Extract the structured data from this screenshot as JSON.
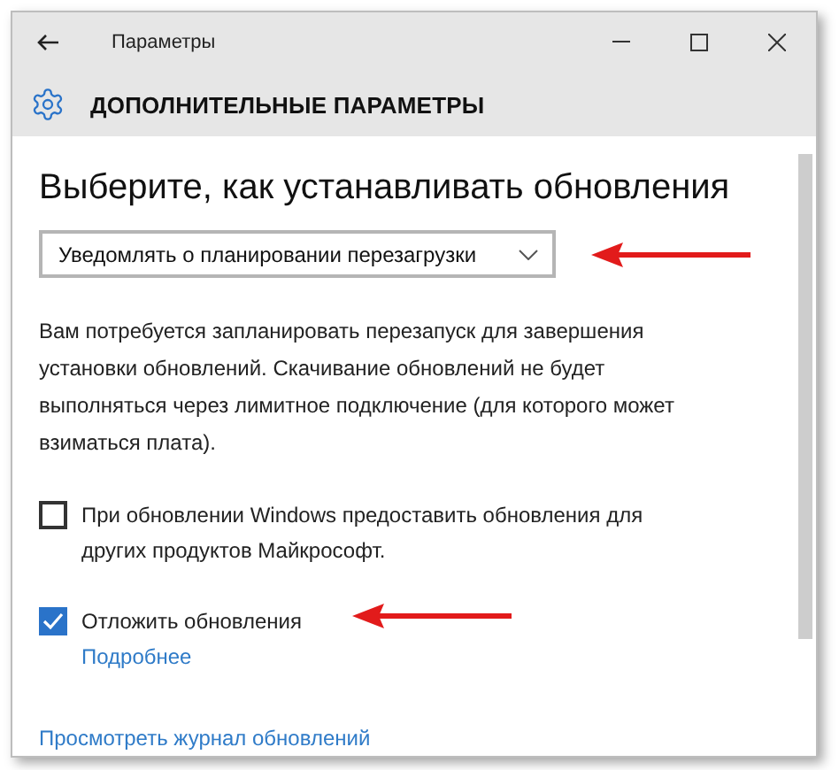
{
  "window": {
    "title": "Параметры"
  },
  "header": {
    "title": "ДОПОЛНИТЕЛЬНЫЕ ПАРАМЕТРЫ"
  },
  "heading": "Выберите, как устанавливать обновления",
  "dropdown": {
    "value": "Уведомлять о планировании перезагрузки",
    "annotated": true
  },
  "description": "Вам потребуется запланировать перезапуск для завершения установки обновлений. Скачивание обновлений не будет выполняться через лимитное подключение (для которого может взиматься плата).",
  "checkboxes": [
    {
      "label": "При обновлении Windows предоставить обновления для других продуктов Майкрософт.",
      "checked": false,
      "annotated": false
    },
    {
      "label": "Отложить обновления",
      "checked": true,
      "annotated": true,
      "link": "Подробнее"
    }
  ],
  "history_link": "Просмотреть журнал обновлений"
}
